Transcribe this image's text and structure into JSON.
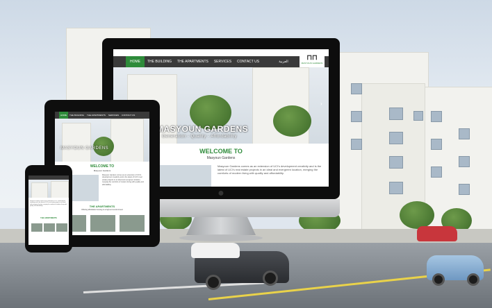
{
  "site": {
    "nav_items": [
      "HOME",
      "THE BUILDING",
      "THE APARTMENTS",
      "SERVICES",
      "CONTACT US"
    ],
    "nav_arabic": "العربية",
    "logo_name": "MASYOUN GARDENS",
    "hero_title": "MASYOUN GARDENS",
    "hero_tagline": "Generation - Quality - Affordability",
    "welcome_heading": "WELCOME TO",
    "welcome_sub": "Masyoun Gardens",
    "welcome_text": "Masyoun Gardens comes as an extension of UCI's development creativity and is the latest of UCI's real estate projects in an ideal and evergreen location, merging the comforts of modern living with quality and affordability.",
    "apartments_heading": "THE APARTMENTS",
    "apartments_sub": "Offering affordable housing in a high-end environment"
  },
  "colors": {
    "accent_green": "#2e8b3a",
    "nav_dark": "#3a3a3a",
    "device_black": "#0d0d0d"
  },
  "icons": {
    "apple": "apple-logo-icon",
    "prev": "chevron-left-icon",
    "next": "chevron-right-icon"
  }
}
